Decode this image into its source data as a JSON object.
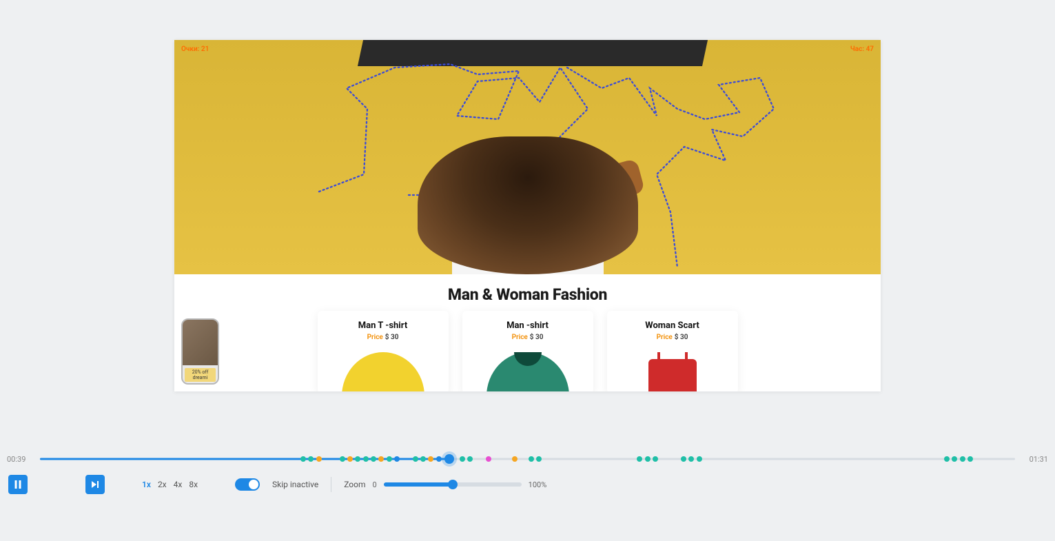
{
  "overlay": {
    "top_left": "Очки: 21",
    "top_right": "Час: 47"
  },
  "section_title": "Man & Woman Fashion",
  "products": [
    {
      "title": "Man T -shirt",
      "price_label": "Price",
      "amount": "$ 30"
    },
    {
      "title": "Man -shirt",
      "price_label": "Price",
      "amount": "$ 30"
    },
    {
      "title": "Woman Scart",
      "price_label": "Price",
      "amount": "$ 30"
    }
  ],
  "side_promo": {
    "label": "20% off dreami"
  },
  "player": {
    "current_time": "00:39",
    "total_time": "01:31",
    "speeds": [
      "1x",
      "2x",
      "4x",
      "8x"
    ],
    "active_speed": "1x",
    "skip_label": "Skip inactive",
    "zoom_label": "Zoom",
    "zoom_min": "0",
    "zoom_max": "100%"
  }
}
